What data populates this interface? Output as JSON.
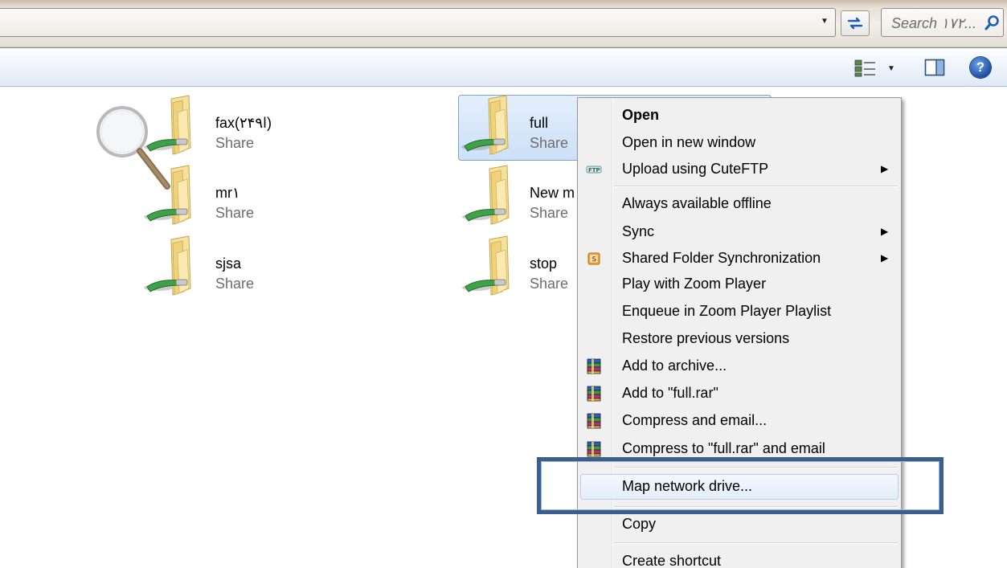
{
  "address_bar": {
    "search_placeholder": "Search ۱۷۲...",
    "dropdown_icon": "chevron-down-icon",
    "refresh_icon": "refresh-arrows-icon",
    "search_icon": "magnifier-icon"
  },
  "toolbar": {
    "views_icon": "change-view-icon",
    "preview_pane_icon": "preview-pane-icon",
    "help_label": "?"
  },
  "folders": [
    {
      "name": "fax(ا۲۴۹)",
      "subtitle": "Share"
    },
    {
      "name": "mr۱",
      "subtitle": "Share"
    },
    {
      "name": "sjsa",
      "subtitle": "Share"
    },
    {
      "name": "full",
      "subtitle": "Share",
      "selected": true
    },
    {
      "name": "New m",
      "subtitle": "Share"
    },
    {
      "name": "stop",
      "subtitle": "Share"
    }
  ],
  "context_menu": {
    "items": [
      {
        "label": "Open",
        "bold": true
      },
      {
        "label": "Open in new window"
      },
      {
        "label": "Upload using CuteFTP",
        "submenu": true,
        "icon": "cuteftp-icon"
      },
      {
        "label": "Always available offline"
      },
      {
        "label": "Sync",
        "submenu": true
      },
      {
        "label": "Shared Folder Synchronization",
        "submenu": true,
        "icon": "sync-s-icon"
      },
      {
        "label": "Play with Zoom Player"
      },
      {
        "label": "Enqueue in Zoom Player Playlist"
      },
      {
        "label": "Restore previous versions"
      },
      {
        "label": "Add to archive...",
        "icon": "winrar-icon"
      },
      {
        "label": "Add to \"full.rar\"",
        "icon": "winrar-icon"
      },
      {
        "label": "Compress and email...",
        "icon": "winrar-icon"
      },
      {
        "label": "Compress to \"full.rar\" and email",
        "icon": "winrar-icon"
      },
      {
        "label": "Map network drive...",
        "hover": true
      },
      {
        "label": "Copy"
      },
      {
        "label": "Create shortcut"
      }
    ],
    "submenu_glyph": "▶"
  },
  "colors": {
    "highlight_border": "#3a5f8d",
    "selection_bg": "#cce0f7",
    "help_blue": "#1d4fa0"
  }
}
